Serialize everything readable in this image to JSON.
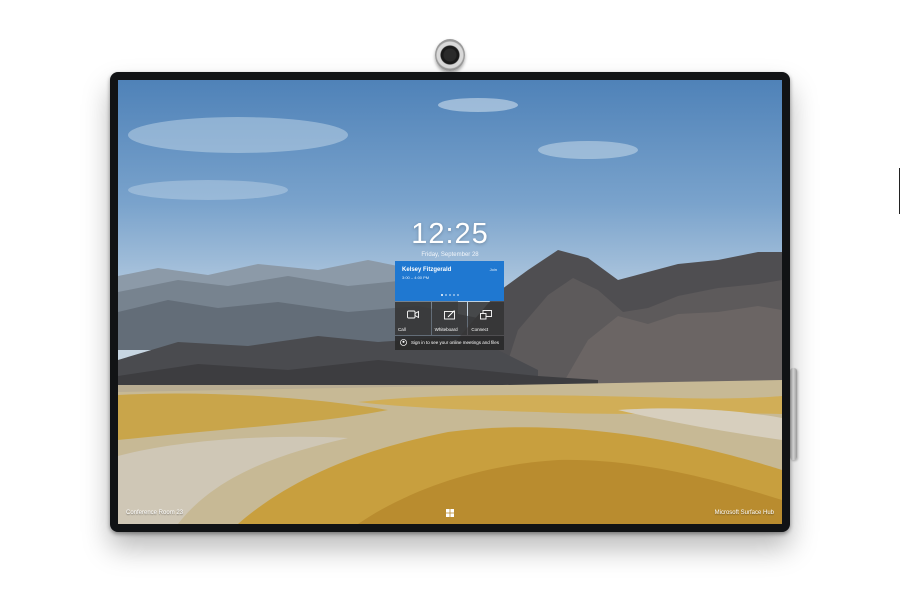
{
  "lock_screen": {
    "time": "12:25",
    "date": "Friday, September 28"
  },
  "meeting_card": {
    "organizer": "Kelsey Fitzgerald",
    "time_range": "3:00 – 4:00 PM",
    "join_label": "Join",
    "page_count": 5,
    "active_page": 1
  },
  "actions": [
    {
      "label": "Call",
      "icon": "video-camera-icon"
    },
    {
      "label": "Whiteboard",
      "icon": "whiteboard-pen-icon"
    },
    {
      "label": "Connect",
      "icon": "connect-screens-icon"
    }
  ],
  "sign_in": {
    "text": "Sign in to see your online meetings and files",
    "icon": "person-icon"
  },
  "footer": {
    "room_name": "Conference Room 23",
    "brand": "Microsoft Surface Hub",
    "start_icon": "windows-logo-icon"
  },
  "colors": {
    "accent": "#1f78d1",
    "tile": "#343434",
    "frame": "#111315"
  }
}
